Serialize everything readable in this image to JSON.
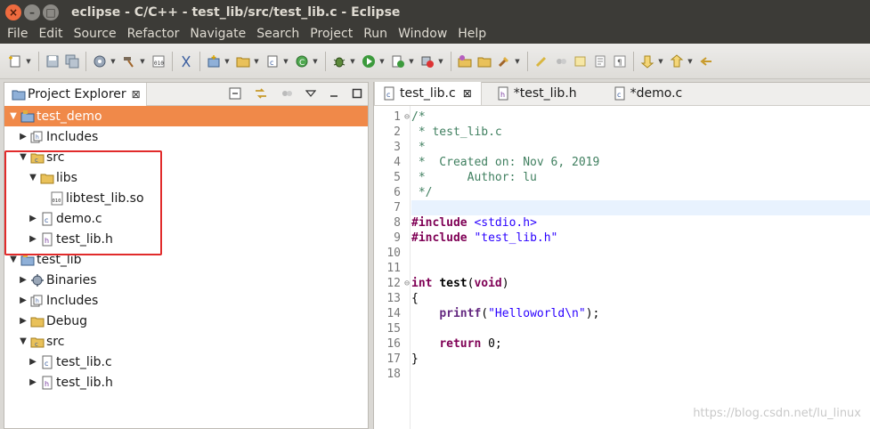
{
  "window": {
    "title": "eclipse - C/C++ - test_lib/src/test_lib.c - Eclipse",
    "close_glyph": "×",
    "min_glyph": "–",
    "max_glyph": "□"
  },
  "menu": [
    "File",
    "Edit",
    "Source",
    "Refactor",
    "Navigate",
    "Search",
    "Project",
    "Run",
    "Window",
    "Help"
  ],
  "project_explorer": {
    "tab_label": "Project Explorer",
    "tab_close": "⊠",
    "tree": [
      {
        "label": "test_demo",
        "depth": 0,
        "twisty": "▼",
        "icon": "project-folder-icon",
        "selected": true
      },
      {
        "label": "Includes",
        "depth": 1,
        "twisty": "▶",
        "icon": "includes-icon"
      },
      {
        "label": "src",
        "depth": 1,
        "twisty": "▼",
        "icon": "source-folder-icon"
      },
      {
        "label": "libs",
        "depth": 2,
        "twisty": "▼",
        "icon": "folder-icon"
      },
      {
        "label": "libtest_lib.so",
        "depth": 3,
        "twisty": "",
        "icon": "binary-file-icon"
      },
      {
        "label": "demo.c",
        "depth": 2,
        "twisty": "▶",
        "icon": "c-file-icon"
      },
      {
        "label": "test_lib.h",
        "depth": 2,
        "twisty": "▶",
        "icon": "h-file-icon"
      },
      {
        "label": "test_lib",
        "depth": 0,
        "twisty": "▼",
        "icon": "project-folder-icon"
      },
      {
        "label": "Binaries",
        "depth": 1,
        "twisty": "▶",
        "icon": "binaries-icon"
      },
      {
        "label": "Includes",
        "depth": 1,
        "twisty": "▶",
        "icon": "includes-icon"
      },
      {
        "label": "Debug",
        "depth": 1,
        "twisty": "▶",
        "icon": "folder-icon"
      },
      {
        "label": "src",
        "depth": 1,
        "twisty": "▼",
        "icon": "source-folder-icon"
      },
      {
        "label": "test_lib.c",
        "depth": 2,
        "twisty": "▶",
        "icon": "c-file-icon"
      },
      {
        "label": "test_lib.h",
        "depth": 2,
        "twisty": "▶",
        "icon": "h-file-icon"
      }
    ]
  },
  "editor": {
    "tabs": [
      {
        "label": "test_lib.c",
        "icon": "c-file-icon",
        "active": true,
        "close": "⊠"
      },
      {
        "label": "*test_lib.h",
        "icon": "h-file-icon",
        "active": false
      },
      {
        "label": "*demo.c",
        "icon": "c-file-icon",
        "active": false
      }
    ],
    "line_numbers": [
      "1",
      "2",
      "3",
      "4",
      "5",
      "6",
      "7",
      "8",
      "9",
      "10",
      "11",
      "12",
      "13",
      "14",
      "15",
      "16",
      "17",
      "18"
    ],
    "fold_markers": {
      "0": "⊖",
      "11": "⊖"
    },
    "current_line": 6,
    "code": [
      [
        {
          "t": "/*",
          "c": "c-cmt"
        }
      ],
      [
        {
          "t": " * test_lib.c",
          "c": "c-cmt"
        }
      ],
      [
        {
          "t": " *",
          "c": "c-cmt"
        }
      ],
      [
        {
          "t": " *  Created on: Nov 6, 2019",
          "c": "c-cmt"
        }
      ],
      [
        {
          "t": " *      Author: lu",
          "c": "c-cmt"
        }
      ],
      [
        {
          "t": " */",
          "c": "c-cmt"
        }
      ],
      [],
      [
        {
          "t": "#include",
          "c": "c-dir"
        },
        {
          "t": " ",
          "c": ""
        },
        {
          "t": "<stdio.h>",
          "c": "c-inc"
        }
      ],
      [
        {
          "t": "#include",
          "c": "c-dir"
        },
        {
          "t": " ",
          "c": ""
        },
        {
          "t": "\"test_lib.h\"",
          "c": "c-str"
        }
      ],
      [],
      [],
      [
        {
          "t": "int",
          "c": "c-kw"
        },
        {
          "t": " ",
          "c": ""
        },
        {
          "t": "test",
          "c": "c-fn"
        },
        {
          "t": "(",
          "c": ""
        },
        {
          "t": "void",
          "c": "c-kw"
        },
        {
          "t": ")",
          "c": ""
        }
      ],
      [
        {
          "t": "{",
          "c": ""
        }
      ],
      [
        {
          "t": "    ",
          "c": ""
        },
        {
          "t": "printf",
          "c": "c-call"
        },
        {
          "t": "(",
          "c": ""
        },
        {
          "t": "\"Helloworld\\n\"",
          "c": "c-str"
        },
        {
          "t": ");",
          "c": ""
        }
      ],
      [],
      [
        {
          "t": "    ",
          "c": ""
        },
        {
          "t": "return",
          "c": "c-kw"
        },
        {
          "t": " 0;",
          "c": ""
        }
      ],
      [
        {
          "t": "}",
          "c": ""
        }
      ],
      []
    ]
  },
  "watermark": "https://blog.csdn.net/lu_linux",
  "colors": {
    "selection": "#f08949",
    "highlight_box": "#e12b2b",
    "comment": "#3f7f5f",
    "keyword": "#7f0055",
    "string": "#2a00ff"
  }
}
